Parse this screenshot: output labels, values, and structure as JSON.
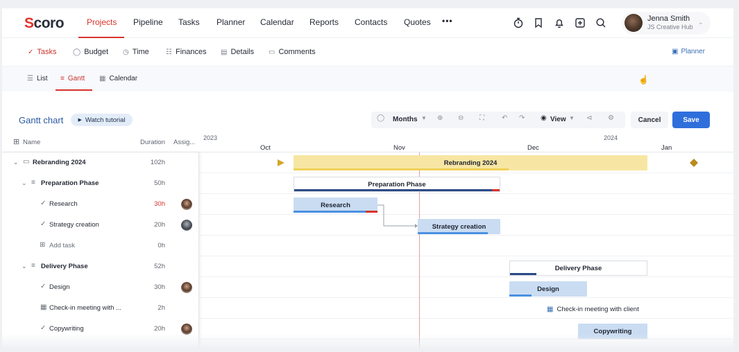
{
  "app": {
    "logo": "Scoro"
  },
  "topnav": {
    "items": [
      "Projects",
      "Pipeline",
      "Tasks",
      "Planner",
      "Calendar",
      "Reports",
      "Contacts",
      "Quotes"
    ],
    "more": "•••"
  },
  "user": {
    "name": "Jenna Smith",
    "org": "JS Creative Hub"
  },
  "subtabs": {
    "items": [
      "Tasks",
      "Budget",
      "Time",
      "Finances",
      "Details",
      "Comments"
    ],
    "planner": "Planner"
  },
  "views": {
    "items": [
      "List",
      "Gantt",
      "Calendar"
    ]
  },
  "gantt": {
    "title": "Gantt chart",
    "tutorial": "Watch tutorial",
    "scale": "Months",
    "view": "View",
    "cancel": "Cancel",
    "save": "Save"
  },
  "columns": {
    "name": "Name",
    "duration": "Duration",
    "assignee": "Assig..."
  },
  "timeline": {
    "years": [
      "2023",
      "2024"
    ],
    "months": [
      "Oct",
      "Nov",
      "Dec",
      "Jan"
    ]
  },
  "rows": [
    {
      "name": "Rebranding 2024",
      "duration": "102h"
    },
    {
      "name": "Preparation Phase",
      "duration": "50h"
    },
    {
      "name": "Research",
      "duration": "30h"
    },
    {
      "name": "Strategy creation",
      "duration": "20h"
    },
    {
      "name": "Add task",
      "duration": "0h"
    },
    {
      "name": "Delivery Phase",
      "duration": "52h"
    },
    {
      "name": "Design",
      "duration": "30h"
    },
    {
      "name": "Check-in meeting with ...",
      "duration": "2h"
    },
    {
      "name": "Copywriting",
      "duration": "20h"
    }
  ],
  "bars": {
    "rebranding": "Rebranding 2024",
    "preparation": "Preparation Phase",
    "research": "Research",
    "strategy": "Strategy creation",
    "delivery": "Delivery Phase",
    "design": "Design",
    "checkin": "Check-in meeting with client",
    "copywriting": "Copywriting"
  },
  "colors": {
    "accent": "#d8342c",
    "primary": "#2f6fdc",
    "summary_project": "#f7e6a3",
    "task_bar": "#c9dcf2"
  }
}
